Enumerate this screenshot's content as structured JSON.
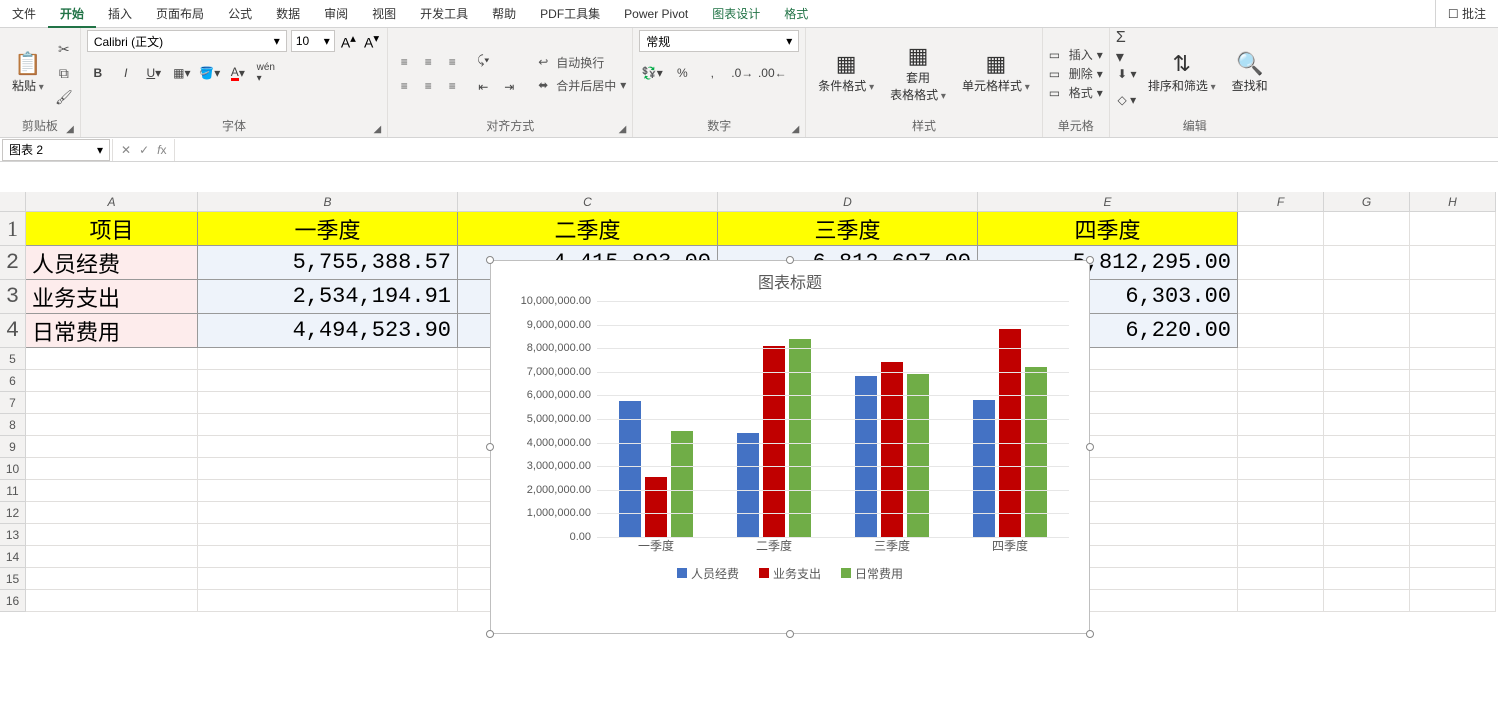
{
  "tabs": {
    "file": "文件",
    "home": "开始",
    "insert": "插入",
    "layout": "页面布局",
    "formula": "公式",
    "data": "数据",
    "review": "审阅",
    "view": "视图",
    "dev": "开发工具",
    "help": "帮助",
    "pdf": "PDF工具集",
    "pivot": "Power Pivot",
    "chartdesign": "图表设计",
    "format": "格式",
    "comment": "批注"
  },
  "ribbon": {
    "clipboard": {
      "paste": "粘贴",
      "label": "剪贴板"
    },
    "font": {
      "name": "Calibri (正文)",
      "size": "10",
      "label": "字体"
    },
    "align": {
      "wrap": "自动换行",
      "merge": "合并后居中",
      "label": "对齐方式"
    },
    "number": {
      "format": "常规",
      "label": "数字"
    },
    "styles": {
      "cond": "条件格式",
      "table": "套用\n表格格式",
      "cell": "单元格样式",
      "label": "样式"
    },
    "cells": {
      "insert": "插入",
      "delete": "删除",
      "format": "格式",
      "label": "单元格"
    },
    "editing": {
      "sort": "排序和筛选",
      "find": "查找和",
      "label": "编辑"
    }
  },
  "namebox": "图表 2",
  "sheet": {
    "cols": [
      "A",
      "B",
      "C",
      "D",
      "E",
      "F",
      "G",
      "H"
    ],
    "headers": {
      "a": "项目",
      "b": "一季度",
      "c": "二季度",
      "d": "三季度",
      "e": "四季度"
    },
    "cats": [
      "人员经费",
      "业务支出",
      "日常费用"
    ],
    "vals": {
      "r2": [
        "5,755,388.57",
        "4,415,893.00",
        "6,812,697.00",
        "5,812,295.00"
      ],
      "r3": [
        "2,534,194.91",
        "",
        "",
        "6,303.00"
      ],
      "r4": [
        "4,494,523.90",
        "",
        "",
        "6,220.00"
      ]
    }
  },
  "chart": {
    "title": "图表标题",
    "series": [
      "人员经费",
      "业务支出",
      "日常费用"
    ],
    "ylabels": [
      "0.00",
      "1,000,000.00",
      "2,000,000.00",
      "3,000,000.00",
      "4,000,000.00",
      "5,000,000.00",
      "6,000,000.00",
      "7,000,000.00",
      "8,000,000.00",
      "9,000,000.00",
      "10,000,000.00"
    ]
  },
  "chart_data": {
    "type": "bar",
    "title": "图表标题",
    "categories": [
      "一季度",
      "二季度",
      "三季度",
      "四季度"
    ],
    "series": [
      {
        "name": "人员经费",
        "values": [
          5755388.57,
          4415893.0,
          6812697.0,
          5812295.0
        ],
        "color": "#4472c4"
      },
      {
        "name": "业务支出",
        "values": [
          2534194.91,
          8100000.0,
          7400000.0,
          8800000.0
        ],
        "color": "#c00000"
      },
      {
        "name": "日常费用",
        "values": [
          4494523.9,
          8400000.0,
          6900000.0,
          7200000.0
        ],
        "color": "#70ad47"
      }
    ],
    "ylim": [
      0,
      10000000
    ],
    "ylabel": "",
    "xlabel": ""
  }
}
